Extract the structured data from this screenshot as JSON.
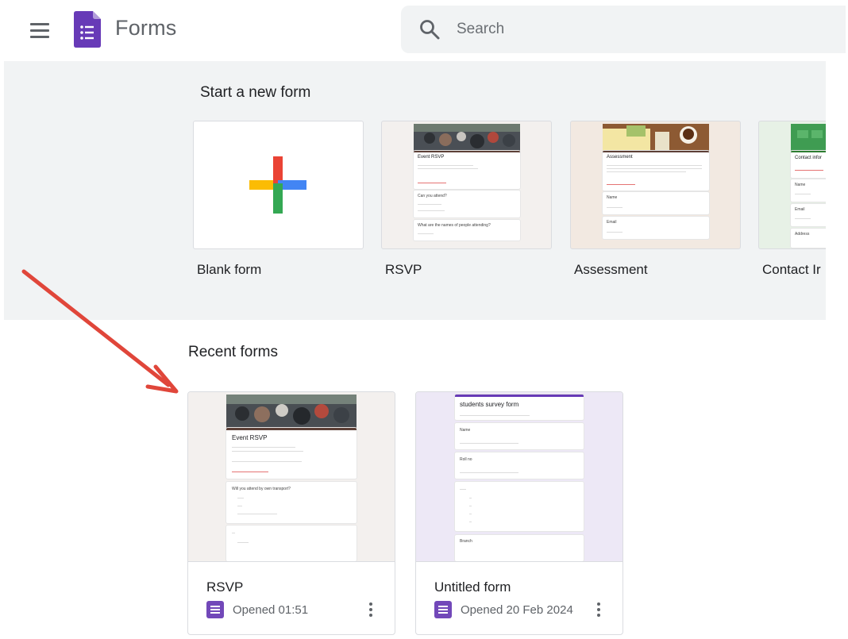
{
  "header": {
    "app_title": "Forms",
    "search_placeholder": "Search"
  },
  "templates": {
    "section_title": "Start a new form",
    "items": [
      {
        "label": "Blank form"
      },
      {
        "label": "RSVP",
        "preview": {
          "title": "Event RSVP",
          "q1": "Can you attend?",
          "q2": "What are the names of people attending?"
        }
      },
      {
        "label": "Assessment",
        "preview": {
          "title": "Assessment",
          "q1": "Name",
          "q2": "Email"
        }
      },
      {
        "label": "Contact Ir",
        "preview": {
          "title": "Contact infor",
          "q1": "Name",
          "q2": "Email",
          "q3": "Address"
        }
      }
    ]
  },
  "recent": {
    "section_title": "Recent forms",
    "items": [
      {
        "name": "RSVP",
        "opened": "Opened 01:51",
        "preview": {
          "title": "Event RSVP",
          "q1": "Will you attend by own transport?"
        }
      },
      {
        "name": "Untitled form",
        "opened": "Opened 20 Feb 2024",
        "preview": {
          "title": "students survey form",
          "q1": "Name",
          "q2": "Roll no",
          "q3": "Branch"
        }
      }
    ]
  },
  "colors": {
    "brand_purple": "#673ab7",
    "annotation_arrow": "#e0463a"
  }
}
